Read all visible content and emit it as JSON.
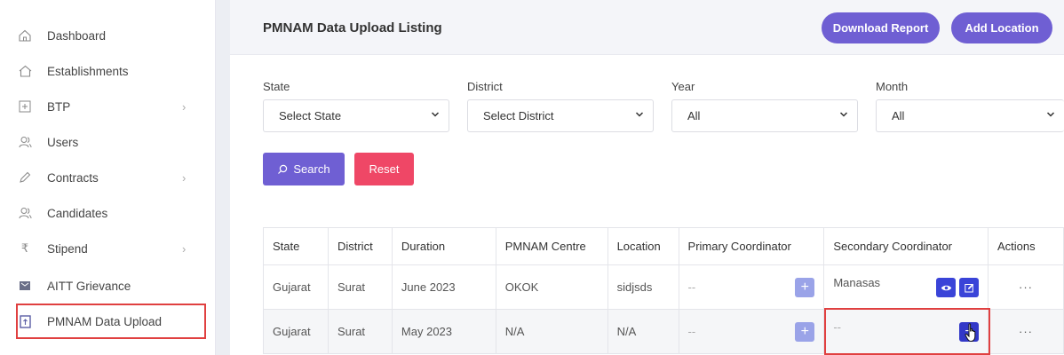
{
  "sidebar": {
    "items": [
      {
        "label": "Dashboard",
        "icon": "home-icon",
        "chevron": false
      },
      {
        "label": "Establishments",
        "icon": "building-icon",
        "chevron": false
      },
      {
        "label": "BTP",
        "icon": "plus-square-icon",
        "chevron": true
      },
      {
        "label": "Users",
        "icon": "users-icon",
        "chevron": false
      },
      {
        "label": "Contracts",
        "icon": "pen-icon",
        "chevron": true
      },
      {
        "label": "Candidates",
        "icon": "users-icon",
        "chevron": false
      },
      {
        "label": "Stipend",
        "icon": "rupee-icon",
        "chevron": true
      },
      {
        "label": "AITT Grievance",
        "icon": "grievance-icon",
        "chevron": false
      },
      {
        "label": "PMNAM Data Upload",
        "icon": "upload-file-icon",
        "chevron": false,
        "active": true
      }
    ]
  },
  "header": {
    "title": "PMNAM Data Upload Listing",
    "download_label": "Download Report",
    "add_label": "Add Location"
  },
  "filters": {
    "state": {
      "label": "State",
      "value": "Select State"
    },
    "district": {
      "label": "District",
      "value": "Select District"
    },
    "year": {
      "label": "Year",
      "value": "All"
    },
    "month": {
      "label": "Month",
      "value": "All"
    },
    "search_label": "Search",
    "reset_label": "Reset"
  },
  "table": {
    "headers": [
      "State",
      "District",
      "Duration",
      "PMNAM Centre",
      "Location",
      "Primary Coordinator",
      "Secondary Coordinator",
      "Actions"
    ],
    "rows": [
      {
        "state": "Gujarat",
        "district": "Surat",
        "duration": "June 2023",
        "centre": "OKOK",
        "location": "sidjsds",
        "primary": "--",
        "secondary": "Manasas",
        "actions": "···"
      },
      {
        "state": "Gujarat",
        "district": "Surat",
        "duration": "May 2023",
        "centre": "N/A",
        "location": "N/A",
        "primary": "--",
        "secondary": "--",
        "actions": "···"
      }
    ]
  },
  "colors": {
    "accent": "#6f5fd3",
    "danger": "#ef4766",
    "highlight": "#e04040"
  }
}
